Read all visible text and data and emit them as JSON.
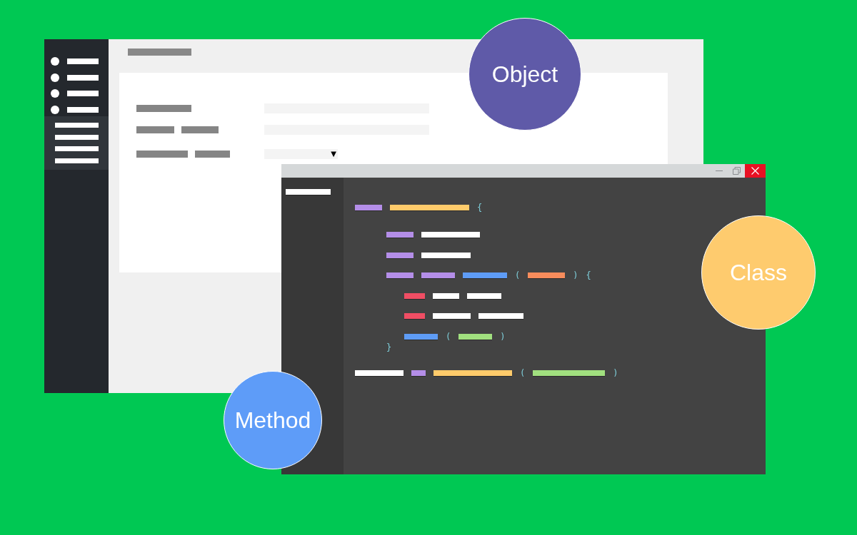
{
  "app_window": {
    "sidebar": {
      "items": [
        {
          "kind": "bullet",
          "selected": false
        },
        {
          "kind": "bullet",
          "selected": false
        },
        {
          "kind": "bullet",
          "selected": false
        },
        {
          "kind": "bullet",
          "selected": false
        },
        {
          "kind": "group",
          "selected": true,
          "children": [
            {
              "kind": "line"
            },
            {
              "kind": "line"
            },
            {
              "kind": "line"
            },
            {
              "kind": "line"
            }
          ]
        }
      ]
    },
    "header": {
      "kind": "bar"
    },
    "form": {
      "rows": [
        {
          "label": [
            {
              "kind": "bar"
            }
          ],
          "field": {
            "kind": "text"
          }
        },
        {
          "label": [
            {
              "kind": "bar"
            },
            {
              "kind": "bar"
            }
          ],
          "field": {
            "kind": "text"
          }
        },
        {
          "label": [
            {
              "kind": "bar"
            },
            {
              "kind": "bar"
            }
          ],
          "field": {
            "kind": "select",
            "caret": "▼"
          }
        }
      ]
    }
  },
  "editor": {
    "title_bar": {
      "controls": [
        {
          "kind": "minimize"
        },
        {
          "kind": "restore"
        },
        {
          "kind": "close"
        }
      ]
    },
    "files": [
      {
        "kind": "bar"
      }
    ],
    "code": {
      "lines": [
        {
          "tokens": [
            {
              "kind": "bar",
              "color": "#b48ee8"
            },
            {
              "kind": "bar",
              "color": "#ffcb6b"
            },
            {
              "kind": "symbol",
              "text": "{"
            }
          ],
          "children": [
            {
              "tokens": [
                {
                  "kind": "bar",
                  "color": "#b48ee8"
                },
                {
                  "kind": "bar",
                  "color": "#ffffff"
                }
              ]
            },
            {
              "tokens": [
                {
                  "kind": "bar",
                  "color": "#b48ee8"
                },
                {
                  "kind": "bar",
                  "color": "#ffffff"
                }
              ]
            },
            {
              "tokens": [
                {
                  "kind": "bar",
                  "color": "#b48ee8"
                },
                {
                  "kind": "bar",
                  "color": "#b48ee8"
                },
                {
                  "kind": "bar",
                  "color": "#5e9cf6"
                },
                {
                  "kind": "symbol",
                  "text": "("
                },
                {
                  "kind": "bar",
                  "color": "#f78c5c"
                },
                {
                  "kind": "symbol",
                  "text": ")"
                },
                {
                  "kind": "symbol",
                  "text": "{"
                }
              ],
              "children": [
                {
                  "tokens": [
                    {
                      "kind": "bar",
                      "color": "#f04e64"
                    },
                    {
                      "kind": "bar",
                      "color": "#ffffff"
                    },
                    {
                      "kind": "bar",
                      "color": "#ffffff"
                    }
                  ]
                },
                {
                  "tokens": [
                    {
                      "kind": "bar",
                      "color": "#f04e64"
                    },
                    {
                      "kind": "bar",
                      "color": "#ffffff"
                    },
                    {
                      "kind": "bar",
                      "color": "#ffffff"
                    }
                  ]
                },
                {
                  "tokens": [
                    {
                      "kind": "bar",
                      "color": "#5e9cf6"
                    },
                    {
                      "kind": "symbol",
                      "text": "("
                    },
                    {
                      "kind": "bar",
                      "color": "#a1e07f"
                    },
                    {
                      "kind": "symbol",
                      "text": ")"
                    }
                  ]
                }
              ]
            },
            {
              "tokens": [
                {
                  "kind": "symbol",
                  "text": "}"
                }
              ]
            }
          ]
        },
        {
          "tokens": [
            {
              "kind": "bar",
              "color": "#ffffff"
            },
            {
              "kind": "bar",
              "color": "#b48ee8"
            },
            {
              "kind": "bar",
              "color": "#ffcb6b"
            },
            {
              "kind": "symbol",
              "text": "("
            },
            {
              "kind": "bar",
              "color": "#a1e07f"
            },
            {
              "kind": "symbol",
              "text": ")"
            }
          ]
        }
      ]
    }
  },
  "bubbles": [
    {
      "label": "Object",
      "color": "#5f5aa8"
    },
    {
      "label": "Class",
      "color": "#fecb6e"
    },
    {
      "label": "Method",
      "color": "#5e9cf8"
    }
  ]
}
